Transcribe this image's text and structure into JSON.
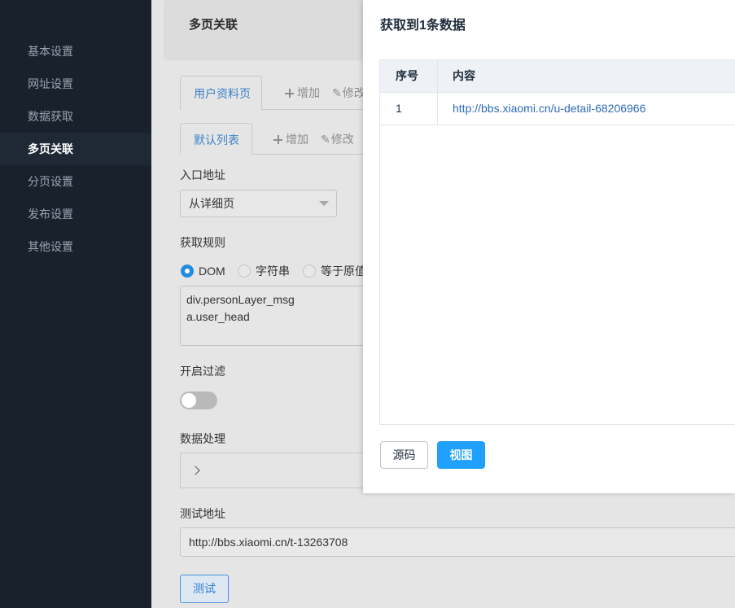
{
  "sidebar": {
    "items": [
      "基本设置",
      "网址设置",
      "数据获取",
      "多页关联",
      "分页设置",
      "发布设置",
      "其他设置"
    ],
    "active_index": 3
  },
  "header": {
    "title": "多页关联"
  },
  "page_tabs": {
    "active": "用户资料页",
    "add": "增加",
    "edit": "修改"
  },
  "list_tabs": {
    "active": "默认列表",
    "add": "增加",
    "edit": "修改"
  },
  "form": {
    "entry_label": "入口地址",
    "entry_value": "从详细页",
    "rule_label": "获取规则",
    "rule_options": [
      {
        "label": "DOM",
        "checked": true
      },
      {
        "label": "字符串",
        "checked": false
      },
      {
        "label": "等于原值",
        "checked": false
      }
    ],
    "rule_value": "div.personLayer_msg\na.user_head",
    "filter_label": "开启过滤",
    "filter_enabled": false,
    "process_label": "数据处理",
    "test_url_label": "测试地址",
    "test_url_value": "http://bbs.xiaomi.cn/t-13263708",
    "test_button": "测试"
  },
  "modal": {
    "title": "获取到1条数据",
    "columns": [
      "序号",
      "内容"
    ],
    "rows": [
      {
        "index": "1",
        "content": "http://bbs.xiaomi.cn/u-detail-68206966"
      }
    ],
    "source_button": "源码",
    "view_button": "视图"
  },
  "colors": {
    "sidebar_bg": "#18212c",
    "primary": "#20a0ff",
    "link": "#2d6cb5"
  }
}
